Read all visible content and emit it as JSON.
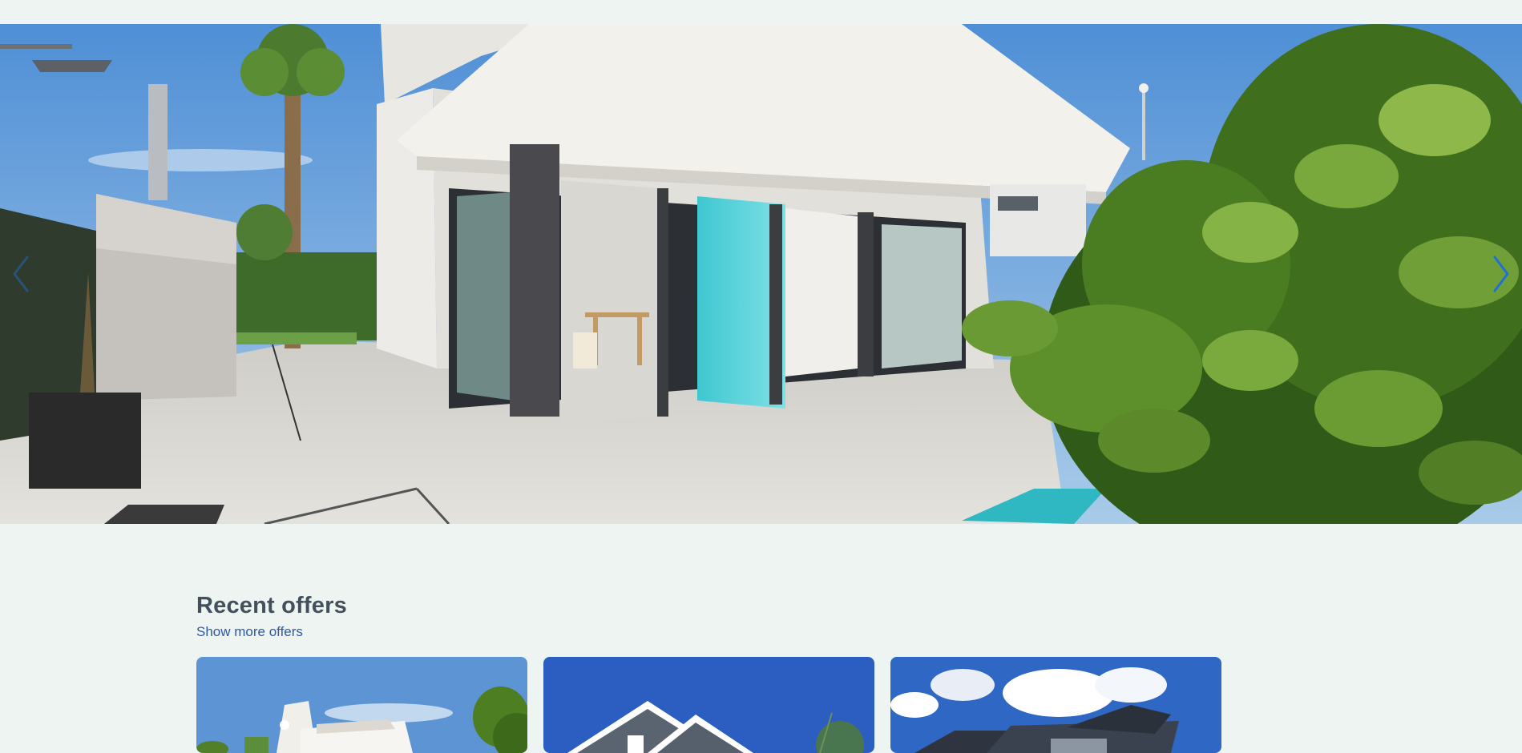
{
  "hero": {
    "prev_icon": "chevron-left-icon",
    "next_icon": "chevron-right-icon",
    "accent_color": "#1e6fd9"
  },
  "offers": {
    "title": "Recent offers",
    "show_more_label": "Show more offers",
    "cards": [
      {
        "image": "modern-white-villa-photo"
      },
      {
        "image": "gray-gabled-house-photo"
      },
      {
        "image": "dark-modern-house-photo"
      }
    ]
  }
}
